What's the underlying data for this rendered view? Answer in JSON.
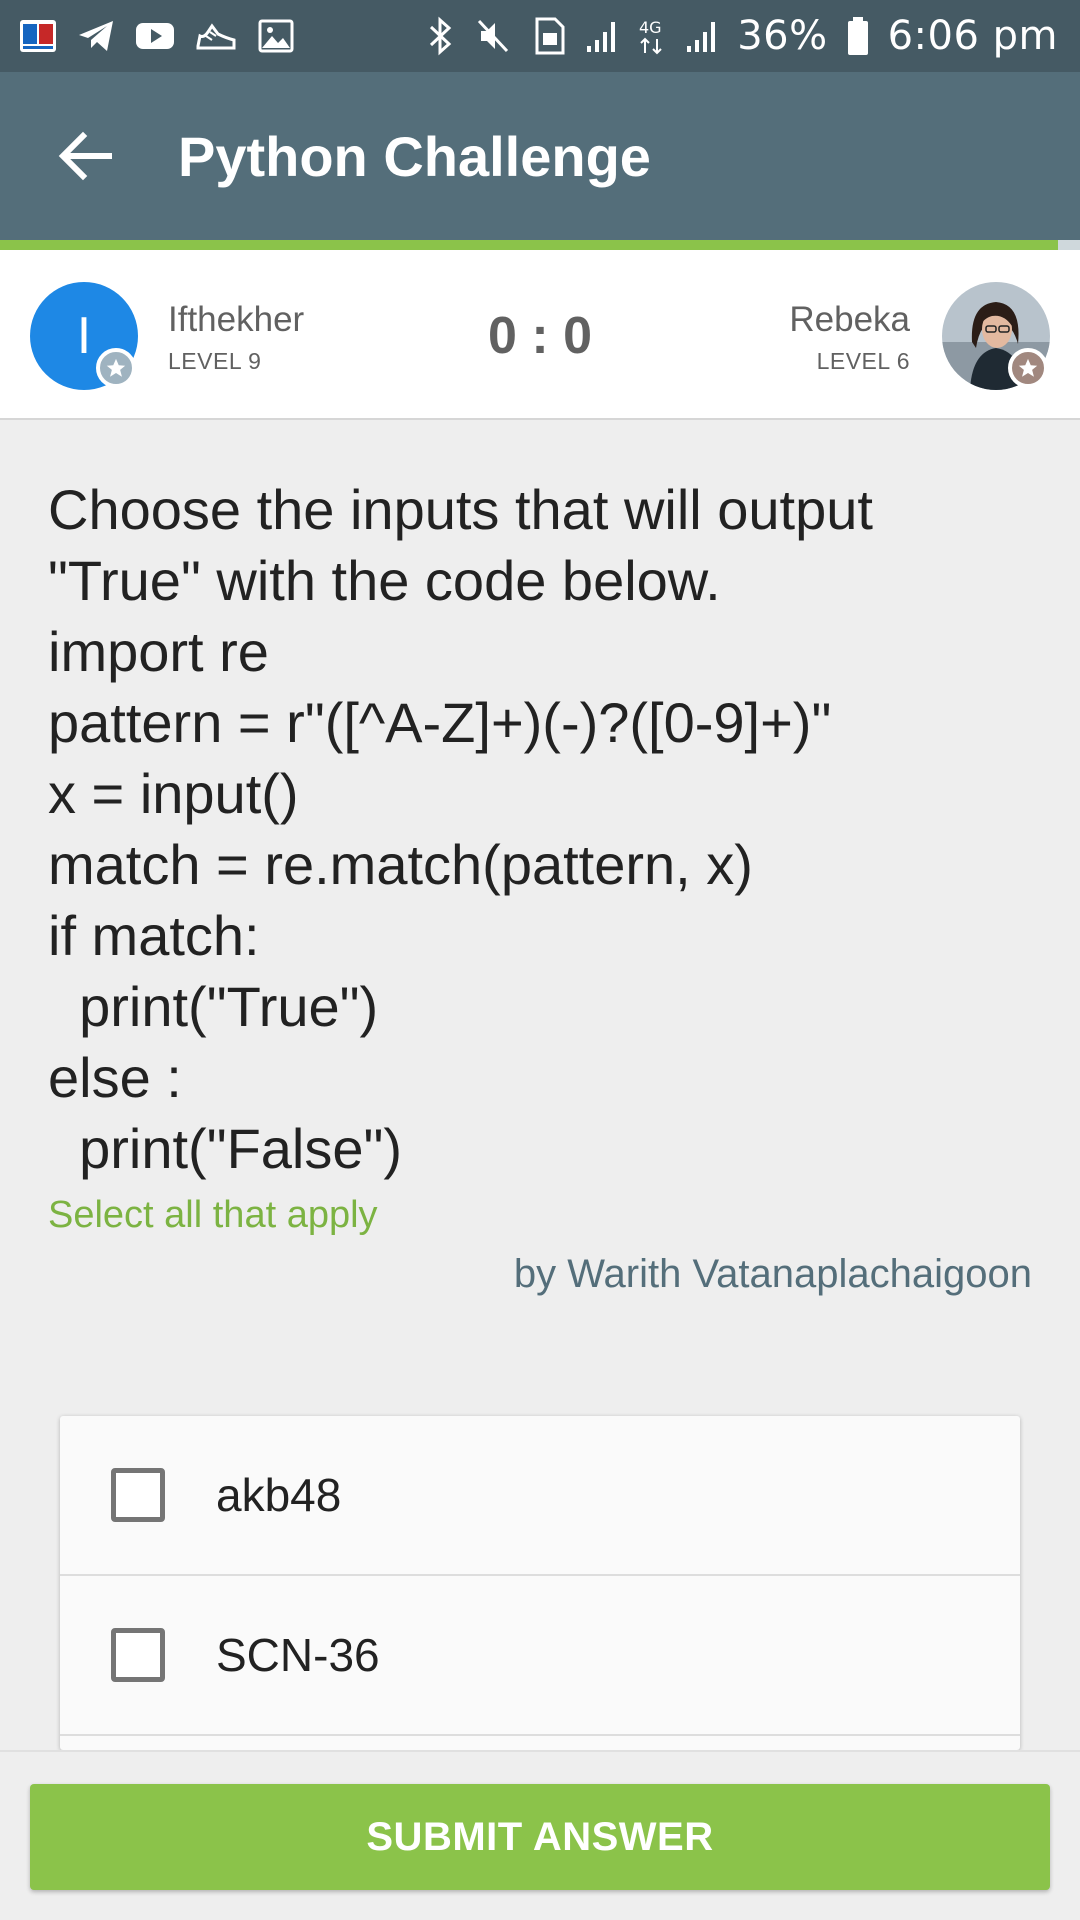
{
  "status_bar": {
    "left_icons": [
      "bangla-app-icon",
      "telegram-icon",
      "youtube-icon",
      "shoe-icon",
      "image-icon"
    ],
    "right_icons": [
      "bluetooth-icon",
      "mute-icon",
      "data-icon",
      "signal-icon",
      "4g-icon",
      "signal-icon",
      "battery-icon"
    ],
    "network": "4G",
    "battery": "36%",
    "time": "6:06 pm"
  },
  "app_bar": {
    "back_icon": "arrow-left-icon",
    "title": "Python Challenge",
    "progress": 0.98
  },
  "players": {
    "left": {
      "initial": "I",
      "name": "Ifthekher",
      "level": "LEVEL 9",
      "badge_icon": "star-icon"
    },
    "score": "0 : 0",
    "right": {
      "name": "Rebeka",
      "level": "LEVEL 6",
      "badge_icon": "star-icon",
      "avatar": "profile-photo"
    }
  },
  "question": {
    "lines": [
      "Choose the inputs that will output",
      "\"True\" with the code below.",
      "import re",
      "pattern = r\"([^A-Z]+)(-)?([0-9]+)\"",
      "x = input()",
      "match = re.match(pattern, x)",
      "if match:",
      "  print(\"True\")",
      "else :",
      "  print(\"False\")"
    ],
    "hint": "Select all that apply",
    "author": "by Warith Vatanaplachaigoon"
  },
  "options": [
    {
      "label": "akb48",
      "checked": false
    },
    {
      "label": "SCN-36",
      "checked": false
    },
    {
      "label": "",
      "checked": false
    }
  ],
  "submit": {
    "label": "SUBMIT ANSWER"
  },
  "colors": {
    "status_bar": "#455a64",
    "app_bar": "#546e7a",
    "accent_green": "#8bc34a",
    "hint_green": "#7cb342",
    "player_left_avatar": "#1e88e5"
  }
}
